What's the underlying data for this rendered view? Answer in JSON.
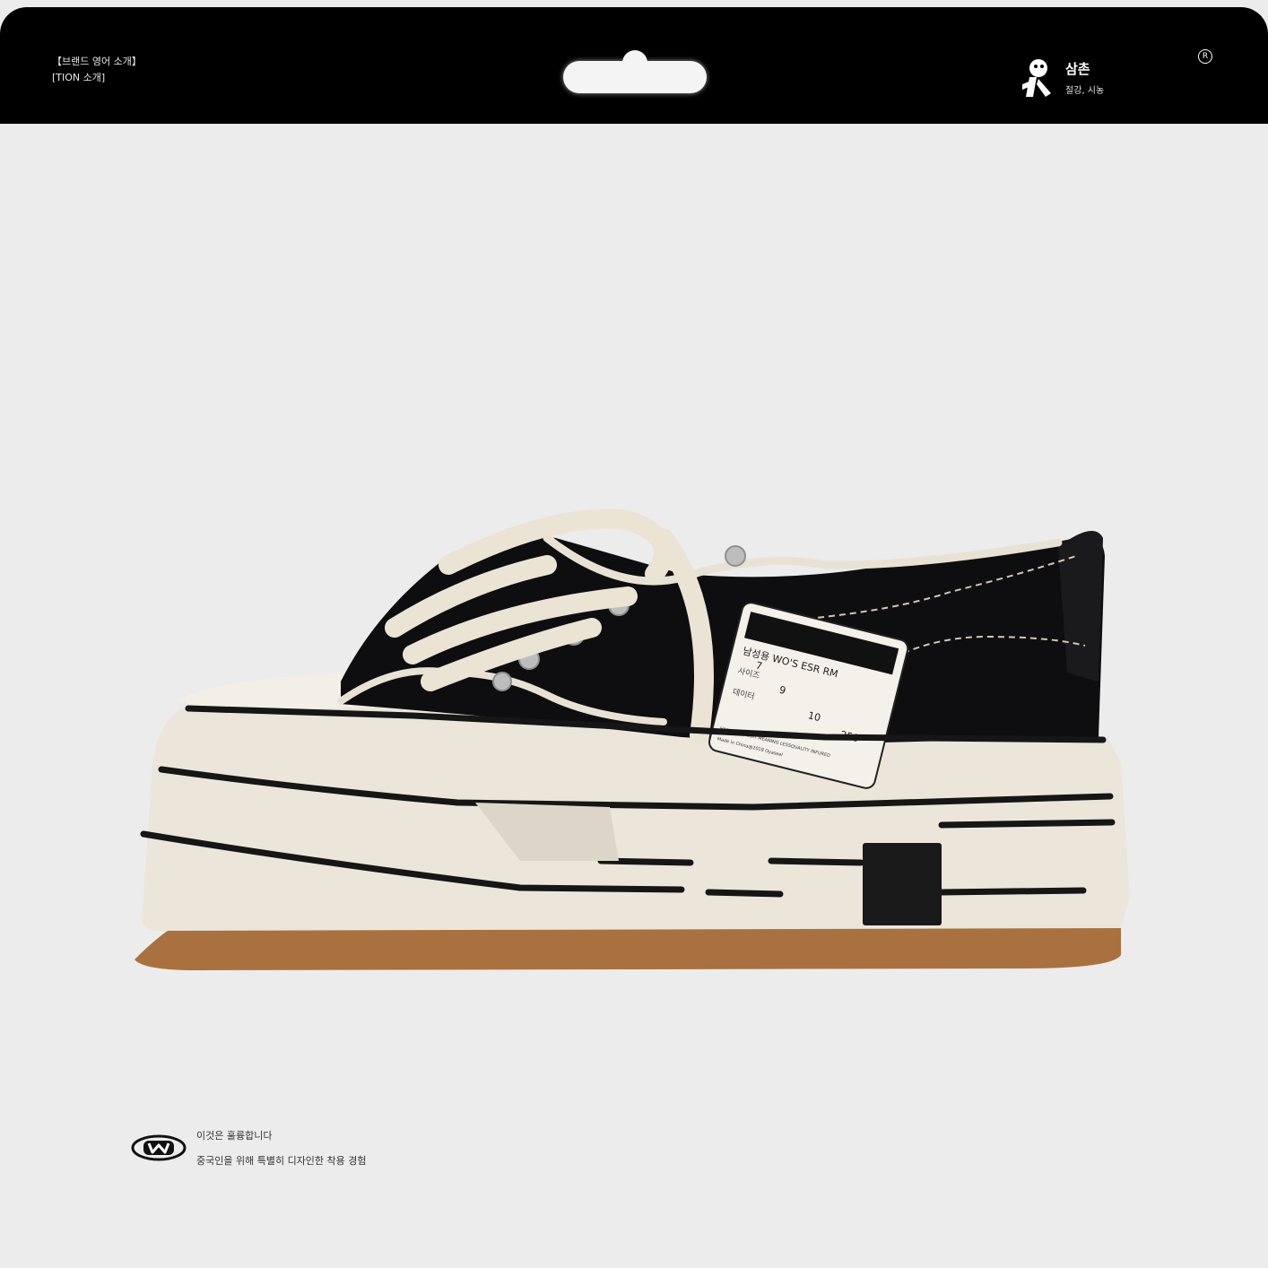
{
  "header": {
    "brand_line_1": "【브랜드 영어 소개】",
    "brand_line_2": "[TION 소개]",
    "logo_title": "삼촌",
    "logo_subtitle": "절강, 시농",
    "registered": "R"
  },
  "tag": {
    "title": "남성용 WO'S ESR RM",
    "row1_label": "사이즈",
    "row2_label": "데이터",
    "numbers": [
      "7",
      "9",
      "10",
      "250"
    ],
    "fine_print_1": "HANDSOME SUIT MEANING LESSQUALITY INFURED",
    "fine_print_2": "Made in China@2018 Oyaseel"
  },
  "footer": {
    "line_1": "이것은 훌륭합니다",
    "line_2": "중국인을 위해 특별히 디자인한 착용 경험"
  },
  "colors": {
    "background": "#ececed",
    "header": "#000000",
    "canvas_upper": "#0e0e10",
    "sole_cream": "#ece6da",
    "outsole_gum": "#a9713f"
  }
}
